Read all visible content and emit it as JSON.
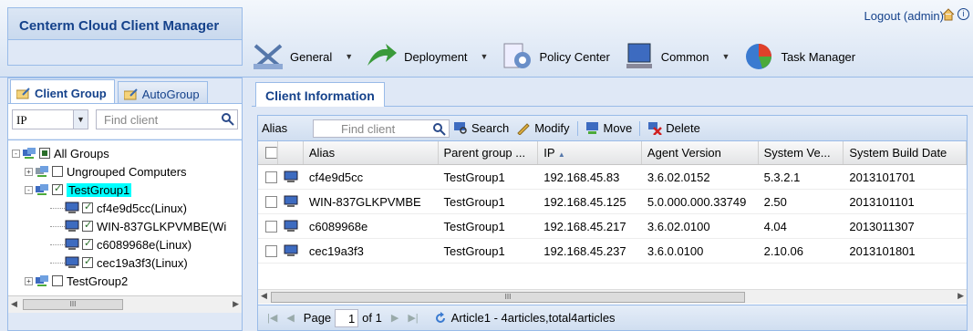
{
  "app": {
    "title": "Centerm Cloud Client Manager",
    "logout": "Logout (admin)"
  },
  "toolbar": [
    {
      "label": "General",
      "icon": "tools-icon",
      "has_menu": true
    },
    {
      "label": "Deployment",
      "icon": "deployment-icon",
      "has_menu": true
    },
    {
      "label": "Policy Center",
      "icon": "gear-policy-icon",
      "has_menu": false
    },
    {
      "label": "Common",
      "icon": "monitor-icon",
      "has_menu": true
    },
    {
      "label": "Task Manager",
      "icon": "pie-chart-icon",
      "has_menu": false
    }
  ],
  "left": {
    "tabs": [
      "Client Group",
      "AutoGroup"
    ],
    "search_field": "IP",
    "search_placeholder": "Find client",
    "tree": [
      {
        "label": "All Groups",
        "level": 0,
        "expander": "-",
        "checked": "partial",
        "type": "group"
      },
      {
        "label": "Ungrouped Computers",
        "level": 1,
        "expander": "+",
        "checked": "none",
        "type": "group-gray"
      },
      {
        "label": "TestGroup1",
        "level": 1,
        "expander": "-",
        "checked": "checked",
        "type": "group",
        "highlight": true
      },
      {
        "label": "cf4e9d5cc(Linux)",
        "level": 2,
        "expander": "",
        "checked": "checked",
        "type": "client"
      },
      {
        "label": "WIN-837GLKPVMBE(Wi",
        "level": 2,
        "expander": "",
        "checked": "checked",
        "type": "client"
      },
      {
        "label": "c6089968e(Linux)",
        "level": 2,
        "expander": "",
        "checked": "checked",
        "type": "client"
      },
      {
        "label": "cec19a3f3(Linux)",
        "level": 2,
        "expander": "",
        "checked": "checked",
        "type": "client"
      },
      {
        "label": "TestGroup2",
        "level": 1,
        "expander": "+",
        "checked": "none",
        "type": "group"
      }
    ]
  },
  "main": {
    "tab": "Client Information",
    "grid_toolbar": {
      "alias_label": "Alias",
      "find_placeholder": "Find client",
      "buttons": [
        "Search",
        "Modify",
        "Move",
        "Delete"
      ]
    },
    "columns": [
      "Alias",
      "Parent group ...",
      "IP",
      "Agent Version",
      "System Ve...",
      "System Build Date"
    ],
    "sort_indicator": "▲",
    "rows": [
      [
        "cf4e9d5cc",
        "TestGroup1",
        "192.168.45.83",
        "3.6.02.0152",
        "5.3.2.1",
        "2013101701"
      ],
      [
        "WIN-837GLKPVMBE",
        "TestGroup1",
        "192.168.45.125",
        "5.0.000.000.33749",
        "2.50",
        "2013101101"
      ],
      [
        "c6089968e",
        "TestGroup1",
        "192.168.45.217",
        "3.6.02.0100",
        "4.04",
        "2013011307"
      ],
      [
        "cec19a3f3",
        "TestGroup1",
        "192.168.45.237",
        "3.6.0.0100",
        "2.10.06",
        "2013101801"
      ]
    ],
    "pager": {
      "page_label": "Page",
      "page": "1",
      "of_label": "of 1",
      "summary": "Article1 - 4articles,total4articles"
    }
  },
  "colors": {
    "accent": "#15428b",
    "border": "#99bbe8",
    "highlight": "#00ffff"
  }
}
